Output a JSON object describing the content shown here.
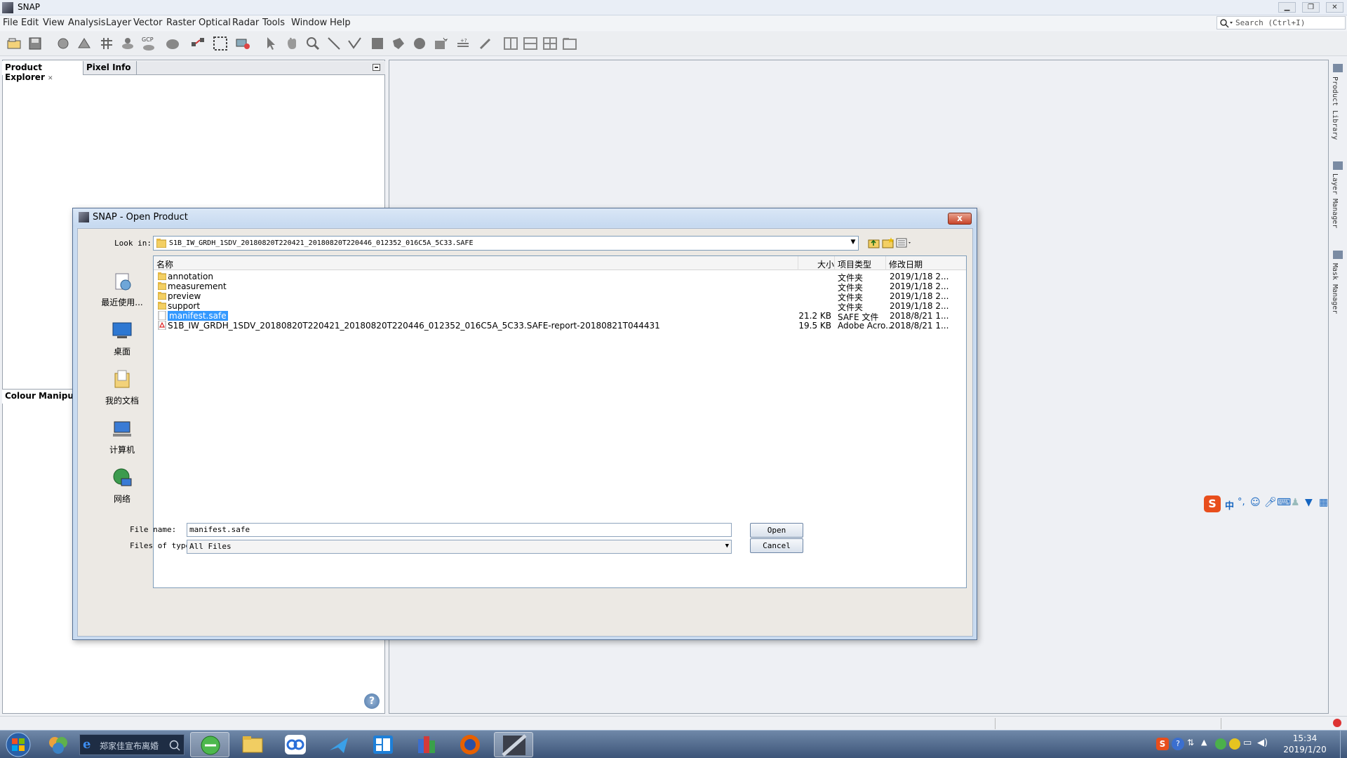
{
  "app": {
    "title": "SNAP"
  },
  "menu": [
    "File",
    "Edit",
    "View",
    "Analysis",
    "Layer",
    "Vector",
    "Raster",
    "Optical",
    "Radar",
    "Tools",
    "Window",
    "Help"
  ],
  "search": {
    "placeholder": "Search (Ctrl+I)"
  },
  "panels": {
    "product_explorer": "Product Explorer",
    "pixel_info": "Pixel Info",
    "colour_manipulation": "Colour Manipulati"
  },
  "right_dock": [
    "Product Library",
    "Layer Manager",
    "Mask Manager"
  ],
  "toolbar": {
    "gcp_label": "GCP"
  },
  "dialog": {
    "title": "SNAP - Open Product",
    "look_in_label": "Look in:",
    "look_in_value": "S1B_IW_GRDH_1SDV_20180820T220421_20180820T220446_012352_016C5A_5C33.SAFE",
    "places": [
      "最近使用...",
      "桌面",
      "我的文档",
      "计算机",
      "网络"
    ],
    "columns": {
      "name": "名称",
      "size": "大小",
      "type": "项目类型",
      "date": "修改日期"
    },
    "files": [
      {
        "name": "annotation",
        "size": "",
        "type": "文件夹",
        "date": "2019/1/18 2...",
        "kind": "folder"
      },
      {
        "name": "measurement",
        "size": "",
        "type": "文件夹",
        "date": "2019/1/18 2...",
        "kind": "folder"
      },
      {
        "name": "preview",
        "size": "",
        "type": "文件夹",
        "date": "2019/1/18 2...",
        "kind": "folder"
      },
      {
        "name": "support",
        "size": "",
        "type": "文件夹",
        "date": "2019/1/18 2...",
        "kind": "folder"
      },
      {
        "name": "manifest.safe",
        "size": "21.2 KB",
        "type": "SAFE 文件",
        "date": "2018/8/21 1...",
        "kind": "file"
      },
      {
        "name": "S1B_IW_GRDH_1SDV_20180820T220421_20180820T220446_012352_016C5A_5C33.SAFE-report-20180821T044431",
        "size": "19.5 KB",
        "type": "Adobe Acro...",
        "date": "2018/8/21 1...",
        "kind": "pdf"
      }
    ],
    "selected_file": "manifest.safe",
    "file_name_label": "File name:",
    "file_name_value": "manifest.safe",
    "file_type_label": "Files of type:",
    "file_type_value": "All Files",
    "open_label": "Open",
    "cancel_label": "Cancel",
    "close_symbol": "x"
  },
  "ime": {
    "label": "中"
  },
  "taskbar": {
    "search_placeholder": "郑家佳宣布离婚",
    "clock_time": "15:34",
    "clock_date": "2019/1/20"
  }
}
